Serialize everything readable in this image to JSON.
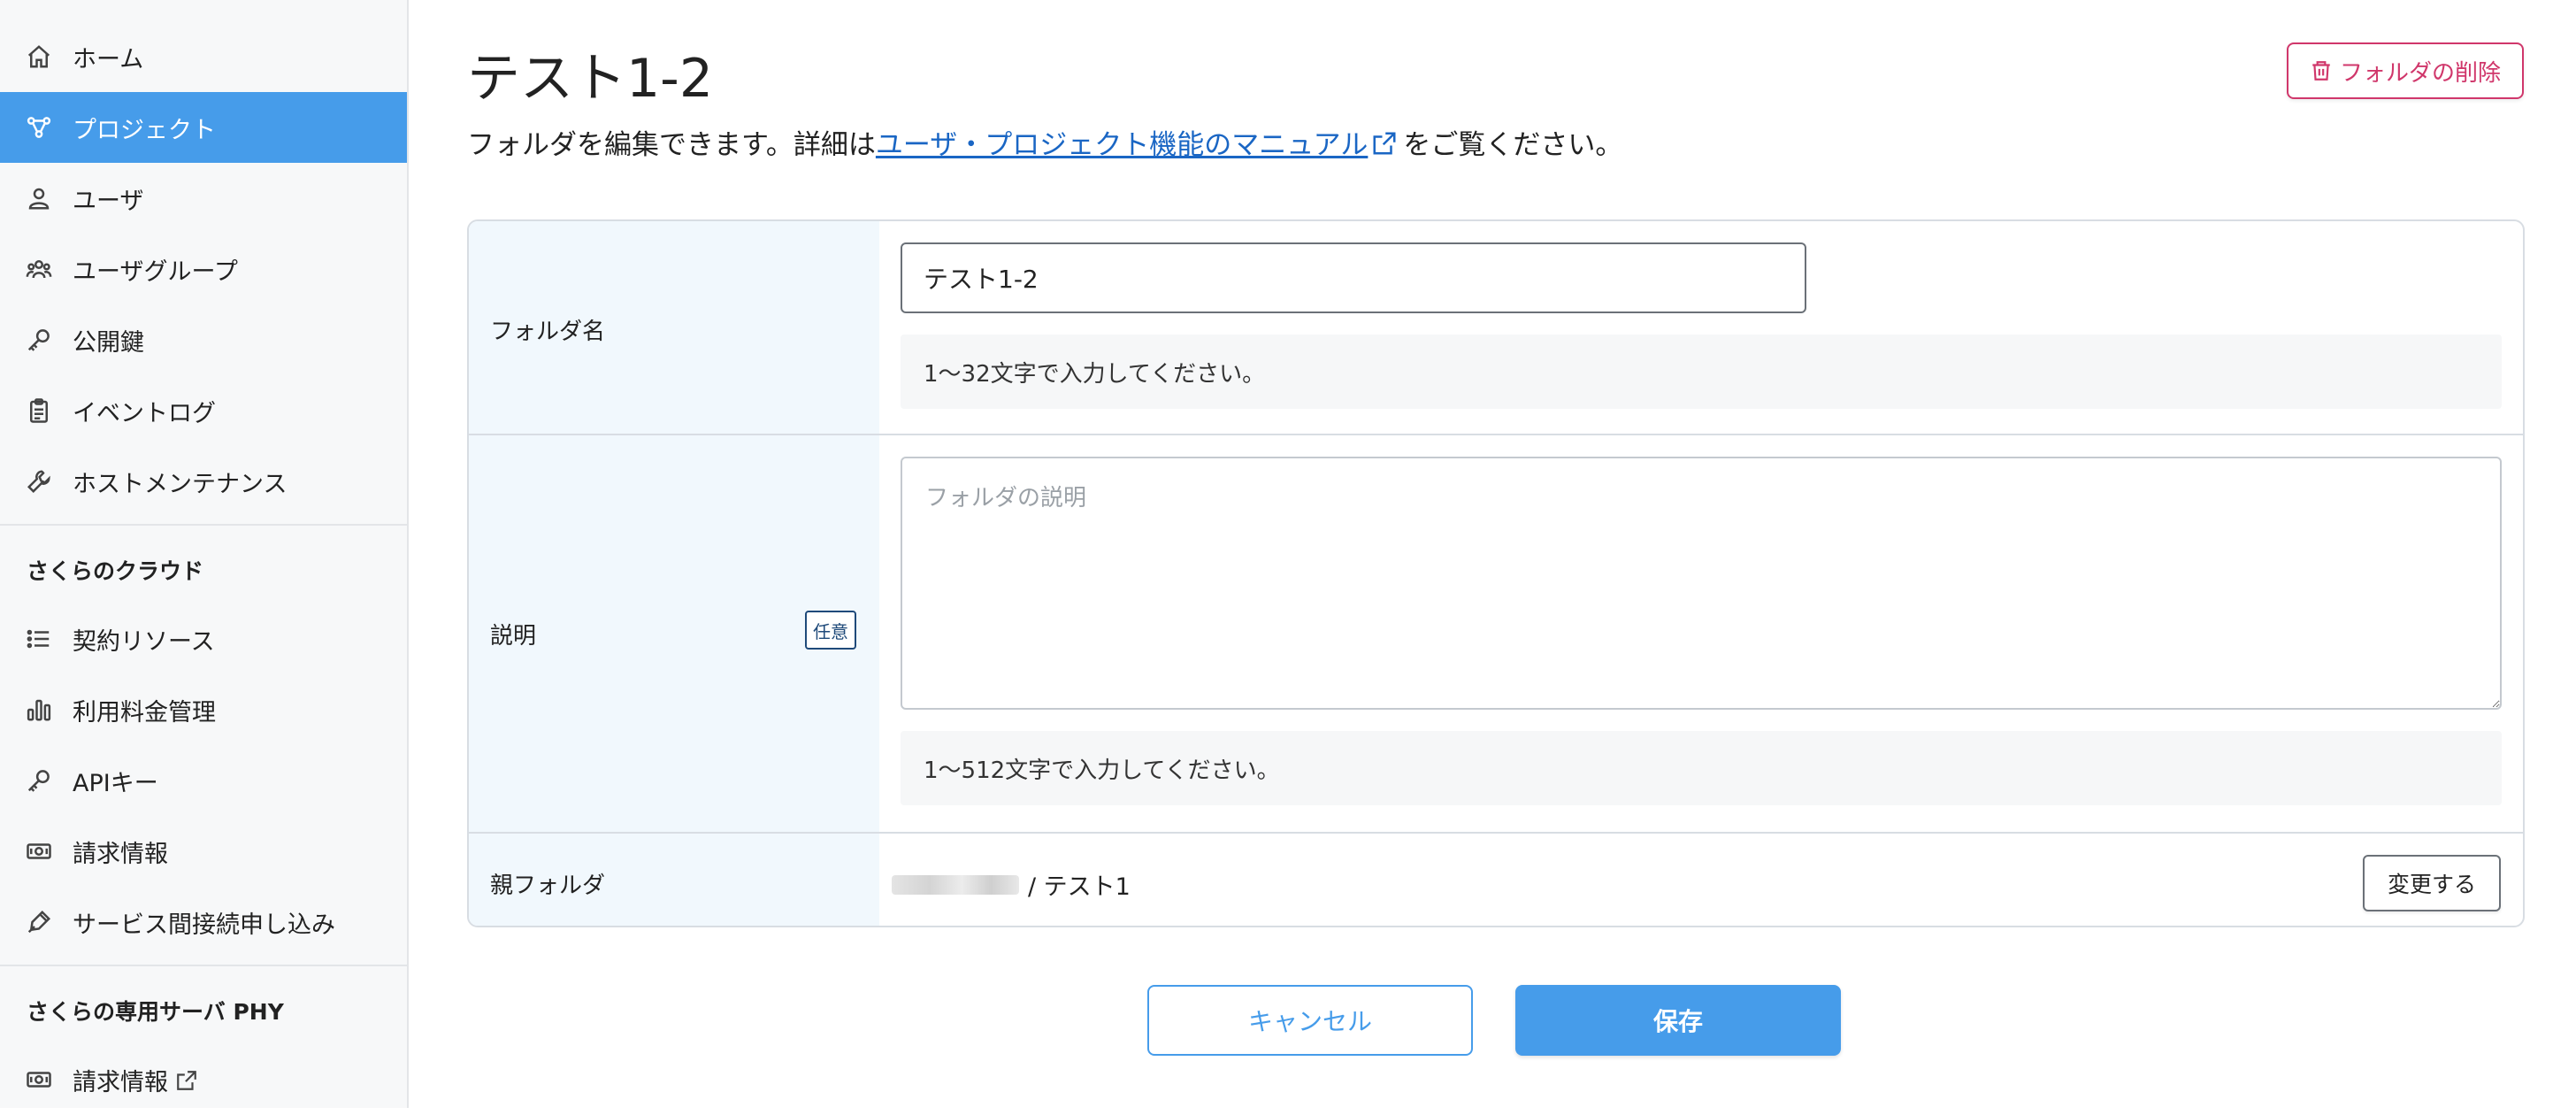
{
  "sidebar": {
    "items": [
      {
        "label": "ホーム",
        "icon": "home-icon",
        "active": false
      },
      {
        "label": "プロジェクト",
        "icon": "project-icon",
        "active": true
      },
      {
        "label": "ユーザ",
        "icon": "user-icon",
        "active": false
      },
      {
        "label": "ユーザグループ",
        "icon": "user-group-icon",
        "active": false
      },
      {
        "label": "公開鍵",
        "icon": "key-icon",
        "active": false
      },
      {
        "label": "イベントログ",
        "icon": "clipboard-icon",
        "active": false
      },
      {
        "label": "ホストメンテナンス",
        "icon": "wrench-icon",
        "active": false
      }
    ],
    "cloud_section": {
      "heading": "さくらのクラウド",
      "items": [
        {
          "label": "契約リソース",
          "icon": "list-icon"
        },
        {
          "label": "利用料金管理",
          "icon": "bar-chart-icon"
        },
        {
          "label": "APIキー",
          "icon": "key-icon"
        },
        {
          "label": "請求情報",
          "icon": "money-icon"
        },
        {
          "label": "サービス間接続申し込み",
          "icon": "pen-icon"
        }
      ]
    },
    "phy_section": {
      "heading": "さくらの専用サーバ PHY",
      "items": [
        {
          "label": "請求情報",
          "icon": "money-icon",
          "external": true
        }
      ]
    }
  },
  "main": {
    "title": "テスト1-2",
    "intro_before": "フォルダを編集できます。詳細は",
    "intro_link": "ユーザ・プロジェクト機能のマニュアル",
    "intro_after": "をご覧ください。",
    "delete_button": "フォルダの削除",
    "form": {
      "folder_name": {
        "label": "フォルダ名",
        "value": "テスト1-2",
        "help": "1〜32文字で入力してください。"
      },
      "description": {
        "label": "説明",
        "badge": "任意",
        "placeholder": "フォルダの説明",
        "value": "",
        "help": "1〜512文字で入力してください。"
      },
      "parent_folder": {
        "label": "親フォルダ",
        "path": "/ テスト1",
        "change_button": "変更する"
      }
    },
    "cancel_button": "キャンセル",
    "save_button": "保存"
  },
  "colors": {
    "accent": "#469cea",
    "danger": "#d0376b",
    "link": "#1a66c4",
    "label_bg": "#f1f8fd"
  }
}
